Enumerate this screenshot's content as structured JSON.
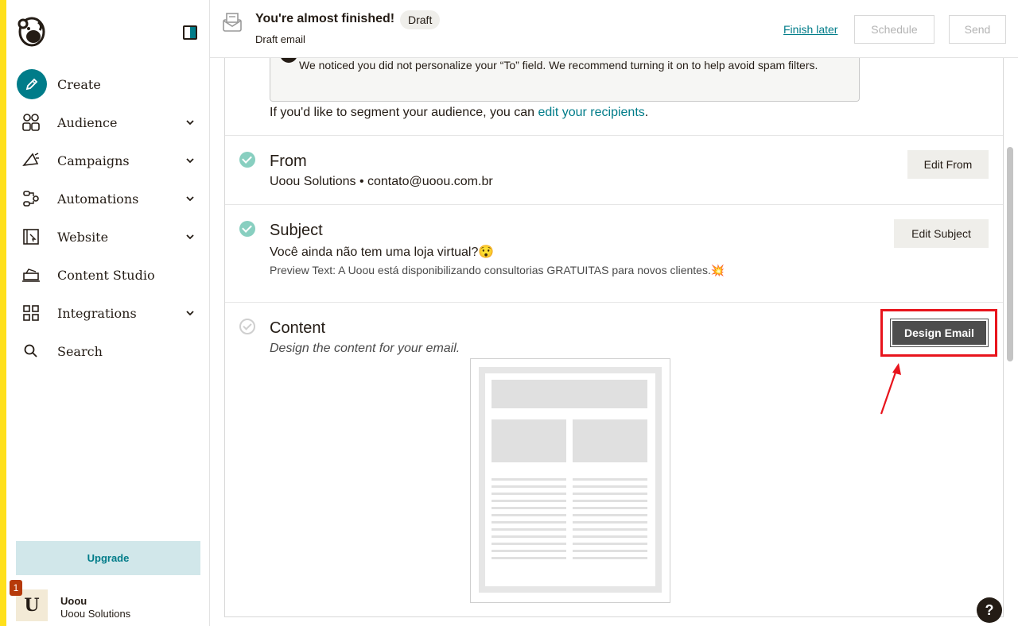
{
  "sidebar": {
    "items": [
      {
        "label": "Create",
        "icon": "pencil-icon"
      },
      {
        "label": "Audience",
        "icon": "audience-icon"
      },
      {
        "label": "Campaigns",
        "icon": "megaphone-icon"
      },
      {
        "label": "Automations",
        "icon": "automations-icon"
      },
      {
        "label": "Website",
        "icon": "website-icon"
      },
      {
        "label": "Content Studio",
        "icon": "content-studio-icon"
      },
      {
        "label": "Integrations",
        "icon": "grid-icon"
      },
      {
        "label": "Search",
        "icon": "search-icon"
      }
    ],
    "upgrade_label": "Upgrade",
    "account": {
      "initial": "U",
      "badge": "1",
      "name": "Uoou",
      "org": "Uoou Solutions"
    }
  },
  "header": {
    "title": "You're almost finished!",
    "badge": "Draft",
    "subtitle": "Draft email",
    "finish_later": "Finish later",
    "schedule": "Schedule",
    "send": "Send"
  },
  "main": {
    "notice": "We noticed you did not personalize your “To” field. We recommend turning it on to help avoid spam filters.",
    "segment_prefix": "If you'd like to segment your audience, you can ",
    "segment_link": "edit your recipients",
    "segment_suffix": ".",
    "from": {
      "title": "From",
      "value": "Uoou Solutions • contato@uoou.com.br",
      "button": "Edit From"
    },
    "subject": {
      "title": "Subject",
      "value": "Você ainda não tem uma loja virtual?😯",
      "preview": "Preview Text: A Uoou está disponibilizando consultorias GRATUITAS para novos clientes.💥",
      "button": "Edit Subject"
    },
    "content": {
      "title": "Content",
      "description": "Design the content for your email.",
      "button": "Design Email"
    }
  },
  "help_label": "?",
  "colors": {
    "brand_yellow": "#ffe01b",
    "accent_teal": "#007c89",
    "highlight_red": "#e8141c"
  }
}
